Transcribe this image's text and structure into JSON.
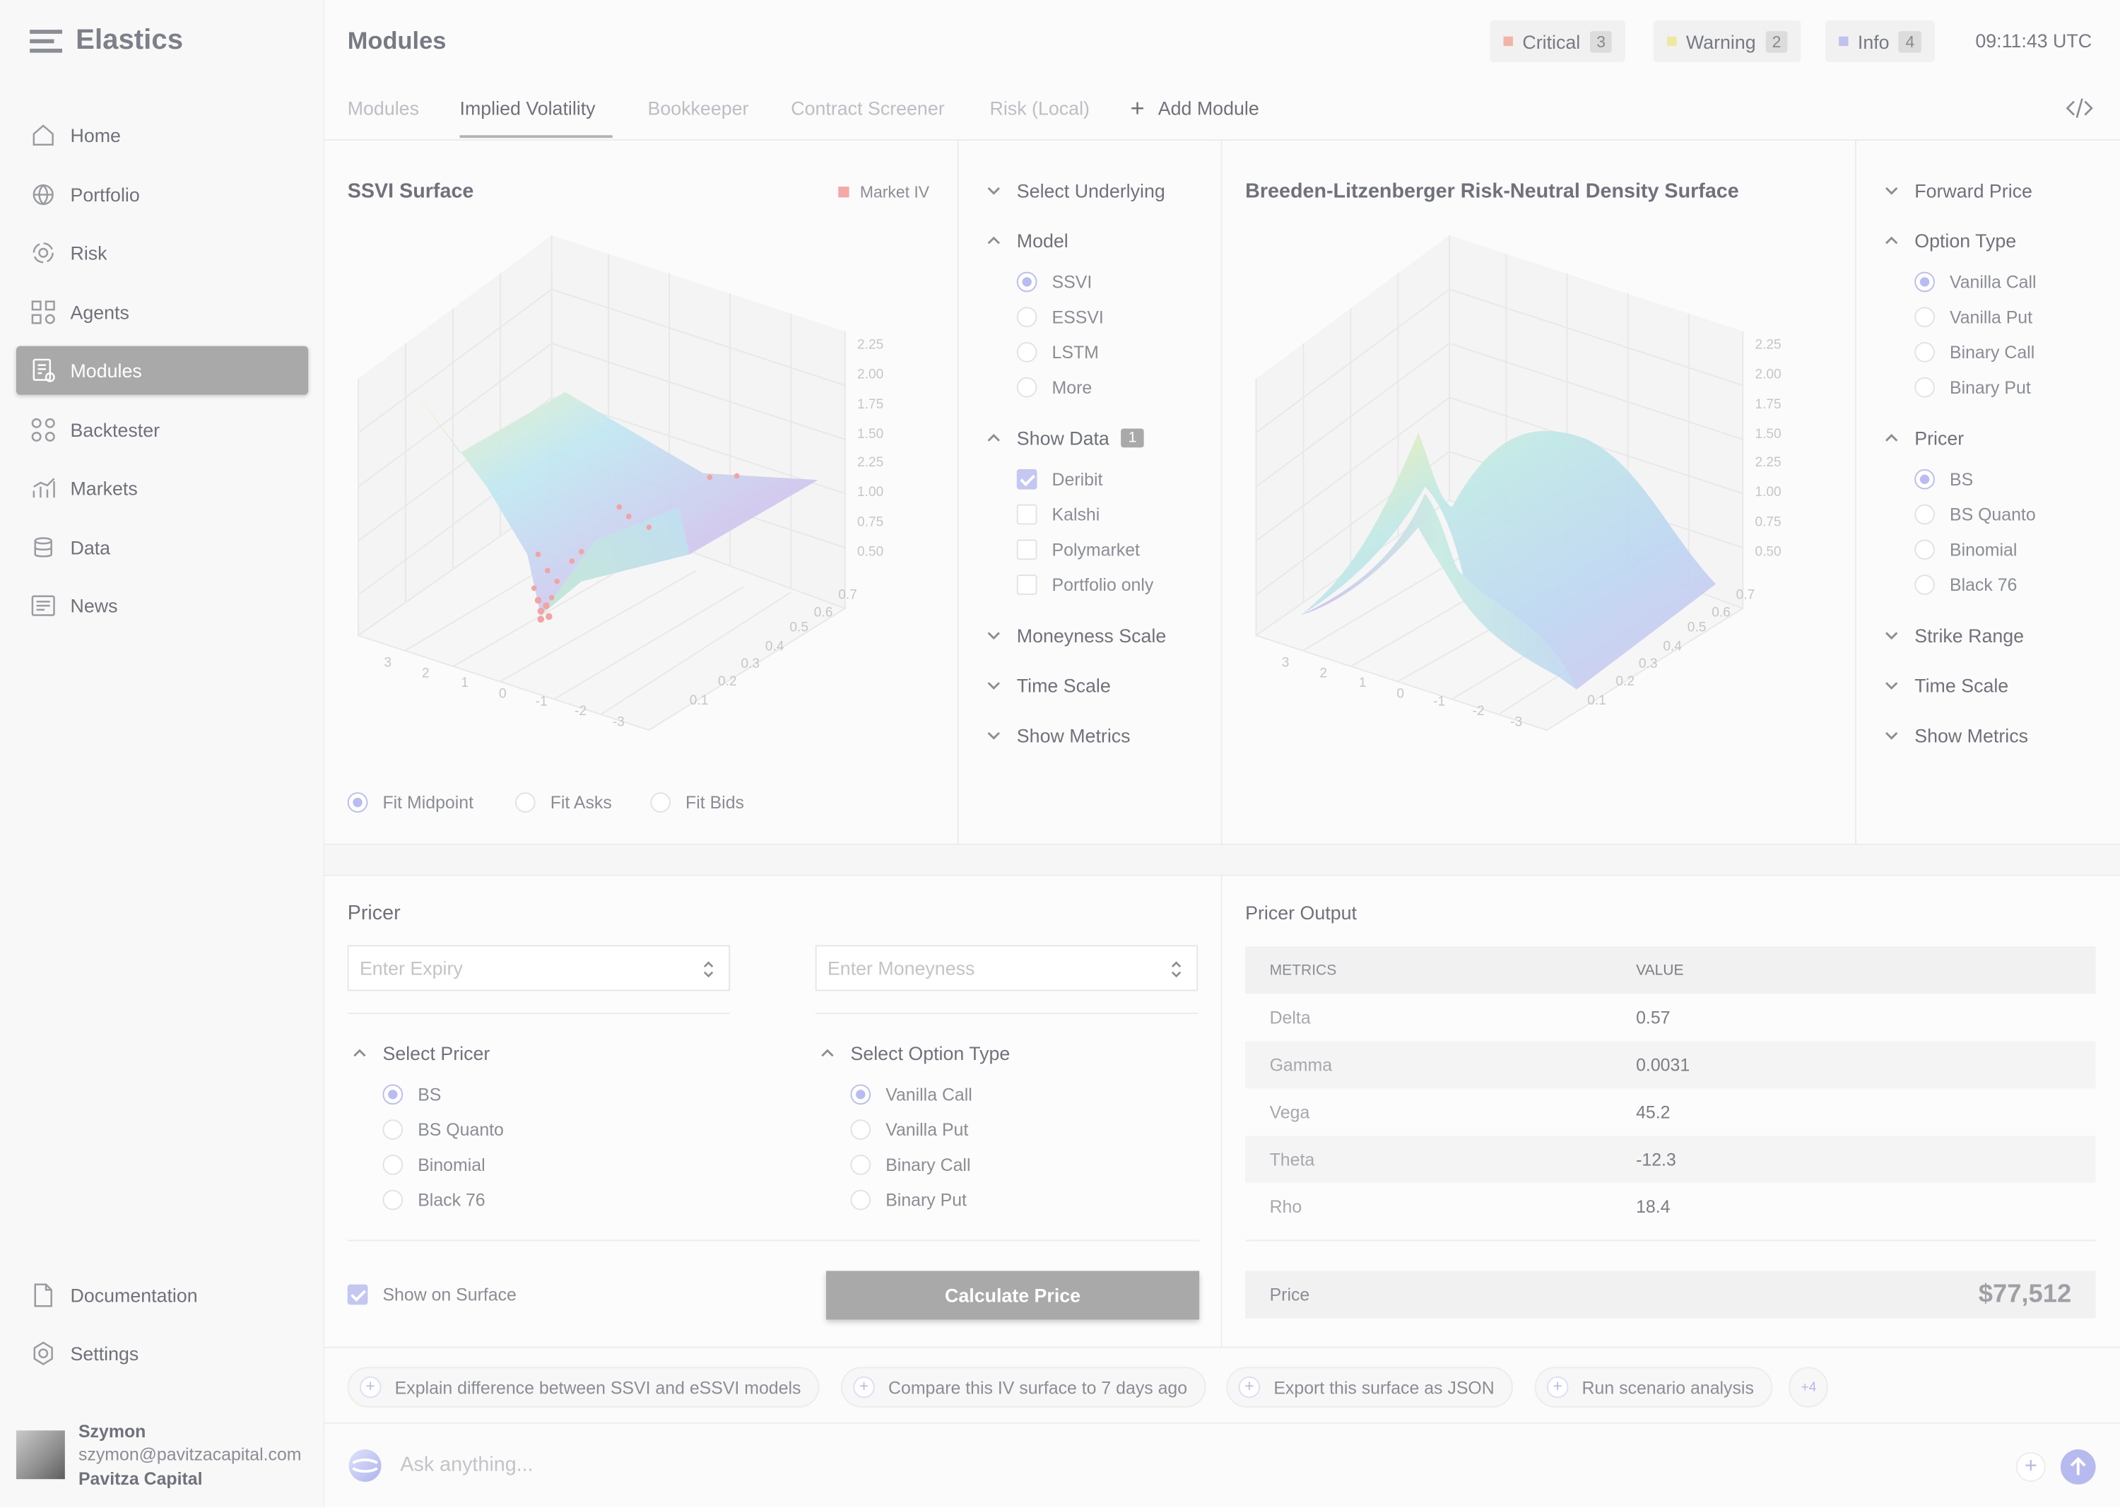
{
  "app": {
    "name": "Elastics",
    "header_title": "Modules",
    "clock": "09:11:43 UTC"
  },
  "alerts": [
    {
      "label": "Critical",
      "count": "3",
      "color": "#f0b3a6"
    },
    {
      "label": "Warning",
      "count": "2",
      "color": "#eee8a3"
    },
    {
      "label": "Info",
      "count": "4",
      "color": "#bfc2ef"
    }
  ],
  "sidebar": {
    "items": [
      {
        "label": "Home",
        "icon": "home-icon"
      },
      {
        "label": "Portfolio",
        "icon": "globe-icon"
      },
      {
        "label": "Risk",
        "icon": "risk-icon"
      },
      {
        "label": "Agents",
        "icon": "agents-icon"
      },
      {
        "label": "Modules",
        "icon": "modules-icon",
        "active": true
      },
      {
        "label": "Backtester",
        "icon": "backtester-icon"
      },
      {
        "label": "Markets",
        "icon": "markets-icon"
      },
      {
        "label": "Data",
        "icon": "data-icon"
      },
      {
        "label": "News",
        "icon": "news-icon"
      }
    ],
    "bottom": [
      {
        "label": "Documentation",
        "icon": "doc-icon"
      },
      {
        "label": "Settings",
        "icon": "settings-icon"
      }
    ],
    "user": {
      "name": "Szymon",
      "email": "szymon@pavitzacapital.com",
      "company": "Pavitza Capital"
    }
  },
  "tabs": [
    "Modules",
    "Implied Volatility",
    "Bookkeeper",
    "Contract Screener",
    "Risk (Local)"
  ],
  "add_module": "Add Module",
  "ssvi": {
    "title": "SSVI Surface",
    "legend": "Market IV",
    "z_ticks": [
      "2.25",
      "2.00",
      "1.75",
      "1.50",
      "2.25",
      "1.00",
      "0.75",
      "0.50"
    ],
    "x_ticks": [
      "3",
      "2",
      "1",
      "0",
      "-1",
      "-2",
      "-3"
    ],
    "t_ticks": [
      "0.1",
      "0.2",
      "0.3",
      "0.4",
      "0.5",
      "0.6",
      "0.7"
    ],
    "fit_options": [
      "Fit Midpoint",
      "Fit Asks",
      "Fit Bids"
    ]
  },
  "left_controls": {
    "select_underlying": "Select Underlying",
    "model": "Model",
    "models": [
      "SSVI",
      "ESSVI",
      "LSTM",
      "More"
    ],
    "show_data": "Show Data",
    "show_data_count": "1",
    "data_sources": [
      "Deribit",
      "Kalshi",
      "Polymarket",
      "Portfolio only"
    ],
    "moneyness_scale": "Moneyness Scale",
    "time_scale": "Time Scale",
    "show_metrics": "Show Metrics"
  },
  "bl": {
    "title": "Breeden-Litzenberger Risk-Neutral Density Surface",
    "z_ticks": [
      "2.25",
      "2.00",
      "1.75",
      "1.50",
      "2.25",
      "1.00",
      "0.75",
      "0.50"
    ],
    "x_ticks": [
      "3",
      "2",
      "1",
      "0",
      "-1",
      "-2",
      "-3"
    ],
    "t_ticks": [
      "0.1",
      "0.2",
      "0.3",
      "0.4",
      "0.5",
      "0.6",
      "0.7"
    ]
  },
  "right_controls": {
    "forward_price": "Forward Price",
    "option_type": "Option Type",
    "option_types": [
      "Vanilla Call",
      "Vanilla Put",
      "Binary Call",
      "Binary Put"
    ],
    "pricer": "Pricer",
    "pricers": [
      "BS",
      "BS Quanto",
      "Binomial",
      "Black 76"
    ],
    "strike_range": "Strike Range",
    "time_scale": "Time Scale",
    "show_metrics": "Show Metrics"
  },
  "pricer": {
    "title": "Pricer",
    "expiry_placeholder": "Enter Expiry",
    "moneyness_placeholder": "Enter Moneyness",
    "select_pricer": "Select Pricer",
    "pricers": [
      "BS",
      "BS Quanto",
      "Binomial",
      "Black 76"
    ],
    "select_option_type": "Select Option Type",
    "option_types": [
      "Vanilla Call",
      "Vanilla Put",
      "Binary Call",
      "Binary Put"
    ],
    "show_on_surface": "Show on Surface",
    "calculate": "Calculate Price"
  },
  "output": {
    "title": "Pricer Output",
    "col_metrics": "METRICS",
    "col_value": "VALUE",
    "rows": [
      [
        "Delta",
        "0.57"
      ],
      [
        "Gamma",
        "0.0031"
      ],
      [
        "Vega",
        "45.2"
      ],
      [
        "Theta",
        "-12.3"
      ],
      [
        "Rho",
        "18.4"
      ]
    ],
    "price_label": "Price",
    "price_value": "$77,512"
  },
  "suggestions": [
    "Explain difference between SSVI and eSSVI models",
    "Compare this IV surface to 7 days ago",
    "Export this surface as JSON",
    "Run scenario analysis"
  ],
  "more_count": "+4",
  "ask_placeholder": "Ask anything..."
}
